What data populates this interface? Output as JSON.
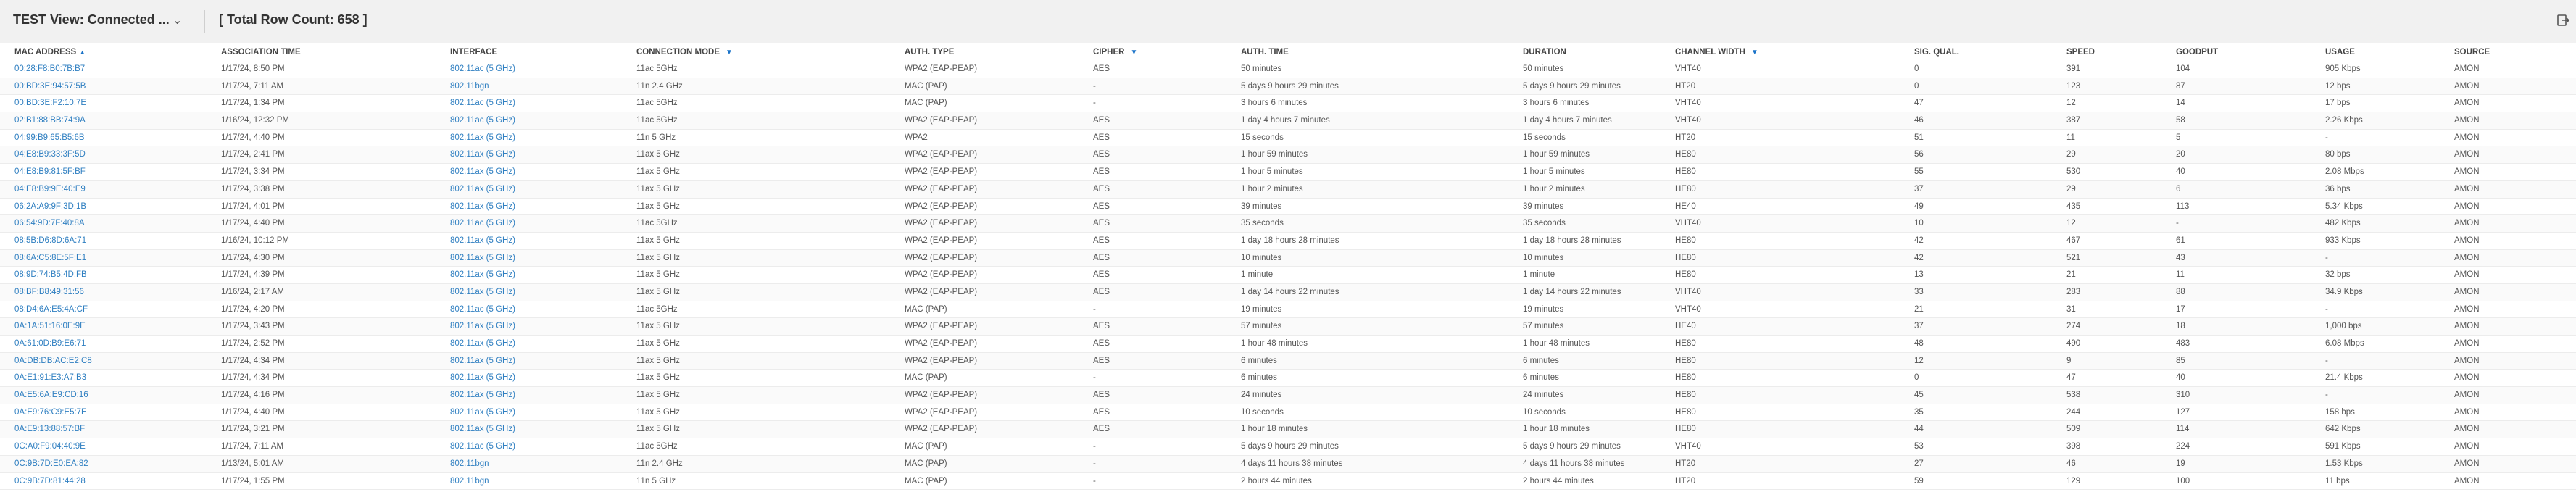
{
  "toolbar": {
    "view_title": "TEST View: Connected ...",
    "row_count_label": "[ Total Row Count: 658 ]",
    "chevron_icon": "chevron-down-icon",
    "export_icon": "export-icon"
  },
  "columns": [
    {
      "key": "mac",
      "label": "MAC ADDRESS",
      "indicator": "sort-asc"
    },
    {
      "key": "assoc",
      "label": "ASSOCIATION TIME",
      "indicator": ""
    },
    {
      "key": "iface",
      "label": "INTERFACE",
      "indicator": ""
    },
    {
      "key": "mode",
      "label": "CONNECTION MODE",
      "indicator": "filter"
    },
    {
      "key": "auth",
      "label": "AUTH. TYPE",
      "indicator": ""
    },
    {
      "key": "cipher",
      "label": "CIPHER",
      "indicator": "filter"
    },
    {
      "key": "authtime",
      "label": "AUTH. TIME",
      "indicator": ""
    },
    {
      "key": "duration",
      "label": "DURATION",
      "indicator": ""
    },
    {
      "key": "width",
      "label": "CHANNEL WIDTH",
      "indicator": "filter"
    },
    {
      "key": "sig",
      "label": "SIG. QUAL.",
      "indicator": ""
    },
    {
      "key": "speed",
      "label": "SPEED",
      "indicator": ""
    },
    {
      "key": "goodput",
      "label": "GOODPUT",
      "indicator": ""
    },
    {
      "key": "usage",
      "label": "USAGE",
      "indicator": ""
    },
    {
      "key": "source",
      "label": "SOURCE",
      "indicator": ""
    }
  ],
  "rows": [
    [
      "00:28:F8:B0:7B:B7",
      "1/17/24, 8:50 PM",
      "802.11ac (5 GHz)",
      "11ac 5GHz",
      "WPA2 (EAP-PEAP)",
      "AES",
      "50 minutes",
      "50 minutes",
      "VHT40",
      "0",
      "391",
      "104",
      "905 Kbps",
      "AMON"
    ],
    [
      "00:BD:3E:94:57:5B",
      "1/17/24, 7:11 AM",
      "802.11bgn",
      "11n 2.4 GHz",
      "MAC (PAP)",
      "-",
      "5 days 9 hours 29 minutes",
      "5 days 9 hours 29 minutes",
      "HT20",
      "0",
      "123",
      "87",
      "12 bps",
      "AMON"
    ],
    [
      "00:BD:3E:F2:10:7E",
      "1/17/24, 1:34 PM",
      "802.11ac (5 GHz)",
      "11ac 5GHz",
      "MAC (PAP)",
      "-",
      "3 hours 6 minutes",
      "3 hours 6 minutes",
      "VHT40",
      "47",
      "12",
      "14",
      "17 bps",
      "AMON"
    ],
    [
      "02:B1:88:BB:74:9A",
      "1/16/24, 12:32 PM",
      "802.11ac (5 GHz)",
      "11ac 5GHz",
      "WPA2 (EAP-PEAP)",
      "AES",
      "1 day 4 hours 7 minutes",
      "1 day 4 hours 7 minutes",
      "VHT40",
      "46",
      "387",
      "58",
      "2.26 Kbps",
      "AMON"
    ],
    [
      "04:99:B9:65:B5:6B",
      "1/17/24, 4:40 PM",
      "802.11ax (5 GHz)",
      "11n 5 GHz",
      "WPA2",
      "AES",
      "15 seconds",
      "15 seconds",
      "HT20",
      "51",
      "11",
      "5",
      "-",
      "AMON"
    ],
    [
      "04:E8:B9:33:3F:5D",
      "1/17/24, 2:41 PM",
      "802.11ax (5 GHz)",
      "11ax 5 GHz",
      "WPA2 (EAP-PEAP)",
      "AES",
      "1 hour 59 minutes",
      "1 hour 59 minutes",
      "HE80",
      "56",
      "29",
      "20",
      "80 bps",
      "AMON"
    ],
    [
      "04:E8:B9:81:5F:BF",
      "1/17/24, 3:34 PM",
      "802.11ax (5 GHz)",
      "11ax 5 GHz",
      "WPA2 (EAP-PEAP)",
      "AES",
      "1 hour 5 minutes",
      "1 hour 5 minutes",
      "HE80",
      "55",
      "530",
      "40",
      "2.08 Mbps",
      "AMON"
    ],
    [
      "04:E8:B9:9E:40:E9",
      "1/17/24, 3:38 PM",
      "802.11ax (5 GHz)",
      "11ax 5 GHz",
      "WPA2 (EAP-PEAP)",
      "AES",
      "1 hour 2 minutes",
      "1 hour 2 minutes",
      "HE80",
      "37",
      "29",
      "6",
      "36 bps",
      "AMON"
    ],
    [
      "06:2A:A9:9F:3D:1B",
      "1/17/24, 4:01 PM",
      "802.11ax (5 GHz)",
      "11ax 5 GHz",
      "WPA2 (EAP-PEAP)",
      "AES",
      "39 minutes",
      "39 minutes",
      "HE40",
      "49",
      "435",
      "113",
      "5.34 Kbps",
      "AMON"
    ],
    [
      "06:54:9D:7F:40:8A",
      "1/17/24, 4:40 PM",
      "802.11ac (5 GHz)",
      "11ac 5GHz",
      "WPA2 (EAP-PEAP)",
      "AES",
      "35 seconds",
      "35 seconds",
      "VHT40",
      "10",
      "12",
      "-",
      "482 Kbps",
      "AMON"
    ],
    [
      "08:5B:D6:8D:6A:71",
      "1/16/24, 10:12 PM",
      "802.11ax (5 GHz)",
      "11ax 5 GHz",
      "WPA2 (EAP-PEAP)",
      "AES",
      "1 day 18 hours 28 minutes",
      "1 day 18 hours 28 minutes",
      "HE80",
      "42",
      "467",
      "61",
      "933 Kbps",
      "AMON"
    ],
    [
      "08:6A:C5:8E:5F:E1",
      "1/17/24, 4:30 PM",
      "802.11ax (5 GHz)",
      "11ax 5 GHz",
      "WPA2 (EAP-PEAP)",
      "AES",
      "10 minutes",
      "10 minutes",
      "HE80",
      "42",
      "521",
      "43",
      "-",
      "AMON"
    ],
    [
      "08:9D:74:B5:4D:FB",
      "1/17/24, 4:39 PM",
      "802.11ax (5 GHz)",
      "11ax 5 GHz",
      "WPA2 (EAP-PEAP)",
      "AES",
      "1 minute",
      "1 minute",
      "HE80",
      "13",
      "21",
      "11",
      "32 bps",
      "AMON"
    ],
    [
      "08:BF:B8:49:31:56",
      "1/16/24, 2:17 AM",
      "802.11ax (5 GHz)",
      "11ax 5 GHz",
      "WPA2 (EAP-PEAP)",
      "AES",
      "1 day 14 hours 22 minutes",
      "1 day 14 hours 22 minutes",
      "VHT40",
      "33",
      "283",
      "88",
      "34.9 Kbps",
      "AMON"
    ],
    [
      "08:D4:6A:E5:4A:CF",
      "1/17/24, 4:20 PM",
      "802.11ac (5 GHz)",
      "11ac 5GHz",
      "MAC (PAP)",
      "-",
      "19 minutes",
      "19 minutes",
      "VHT40",
      "21",
      "31",
      "17",
      "-",
      "AMON"
    ],
    [
      "0A:1A:51:16:0E:9E",
      "1/17/24, 3:43 PM",
      "802.11ax (5 GHz)",
      "11ax 5 GHz",
      "WPA2 (EAP-PEAP)",
      "AES",
      "57 minutes",
      "57 minutes",
      "HE40",
      "37",
      "274",
      "18",
      "1,000 bps",
      "AMON"
    ],
    [
      "0A:61:0D:B9:E6:71",
      "1/17/24, 2:52 PM",
      "802.11ax (5 GHz)",
      "11ax 5 GHz",
      "WPA2 (EAP-PEAP)",
      "AES",
      "1 hour 48 minutes",
      "1 hour 48 minutes",
      "HE80",
      "48",
      "490",
      "483",
      "6.08 Mbps",
      "AMON"
    ],
    [
      "0A:DB:DB:AC:E2:C8",
      "1/17/24, 4:34 PM",
      "802.11ax (5 GHz)",
      "11ax 5 GHz",
      "WPA2 (EAP-PEAP)",
      "AES",
      "6 minutes",
      "6 minutes",
      "HE80",
      "12",
      "9",
      "85",
      "-",
      "AMON"
    ],
    [
      "0A:E1:91:E3:A7:B3",
      "1/17/24, 4:34 PM",
      "802.11ax (5 GHz)",
      "11ax 5 GHz",
      "MAC (PAP)",
      "-",
      "6 minutes",
      "6 minutes",
      "HE80",
      "0",
      "47",
      "40",
      "21.4 Kbps",
      "AMON"
    ],
    [
      "0A:E5:6A:E9:CD:16",
      "1/17/24, 4:16 PM",
      "802.11ax (5 GHz)",
      "11ax 5 GHz",
      "WPA2 (EAP-PEAP)",
      "AES",
      "24 minutes",
      "24 minutes",
      "HE80",
      "45",
      "538",
      "310",
      "-",
      "AMON"
    ],
    [
      "0A:E9:76:C9:E5:7E",
      "1/17/24, 4:40 PM",
      "802.11ax (5 GHz)",
      "11ax 5 GHz",
      "WPA2 (EAP-PEAP)",
      "AES",
      "10 seconds",
      "10 seconds",
      "HE80",
      "35",
      "244",
      "127",
      "158 bps",
      "AMON"
    ],
    [
      "0A:E9:13:88:57:BF",
      "1/17/24, 3:21 PM",
      "802.11ax (5 GHz)",
      "11ax 5 GHz",
      "WPA2 (EAP-PEAP)",
      "AES",
      "1 hour 18 minutes",
      "1 hour 18 minutes",
      "HE80",
      "44",
      "509",
      "114",
      "642 Kbps",
      "AMON"
    ],
    [
      "0C:A0:F9:04:40:9E",
      "1/17/24, 7:11 AM",
      "802.11ac (5 GHz)",
      "11ac 5GHz",
      "MAC (PAP)",
      "-",
      "5 days 9 hours 29 minutes",
      "5 days 9 hours 29 minutes",
      "VHT40",
      "53",
      "398",
      "224",
      "591 Kbps",
      "AMON"
    ],
    [
      "0C:9B:7D:E0:EA:82",
      "1/13/24, 5:01 AM",
      "802.11bgn",
      "11n 2.4 GHz",
      "MAC (PAP)",
      "-",
      "4 days 11 hours 38 minutes",
      "4 days 11 hours 38 minutes",
      "HT20",
      "27",
      "46",
      "19",
      "1.53 Kbps",
      "AMON"
    ],
    [
      "0C:9B:7D:81:44:28",
      "1/17/24, 1:55 PM",
      "802.11bgn",
      "11n 5 GHz",
      "MAC (PAP)",
      "-",
      "2 hours 44 minutes",
      "2 hours 44 minutes",
      "HT20",
      "59",
      "129",
      "100",
      "11 bps",
      "AMON"
    ]
  ]
}
